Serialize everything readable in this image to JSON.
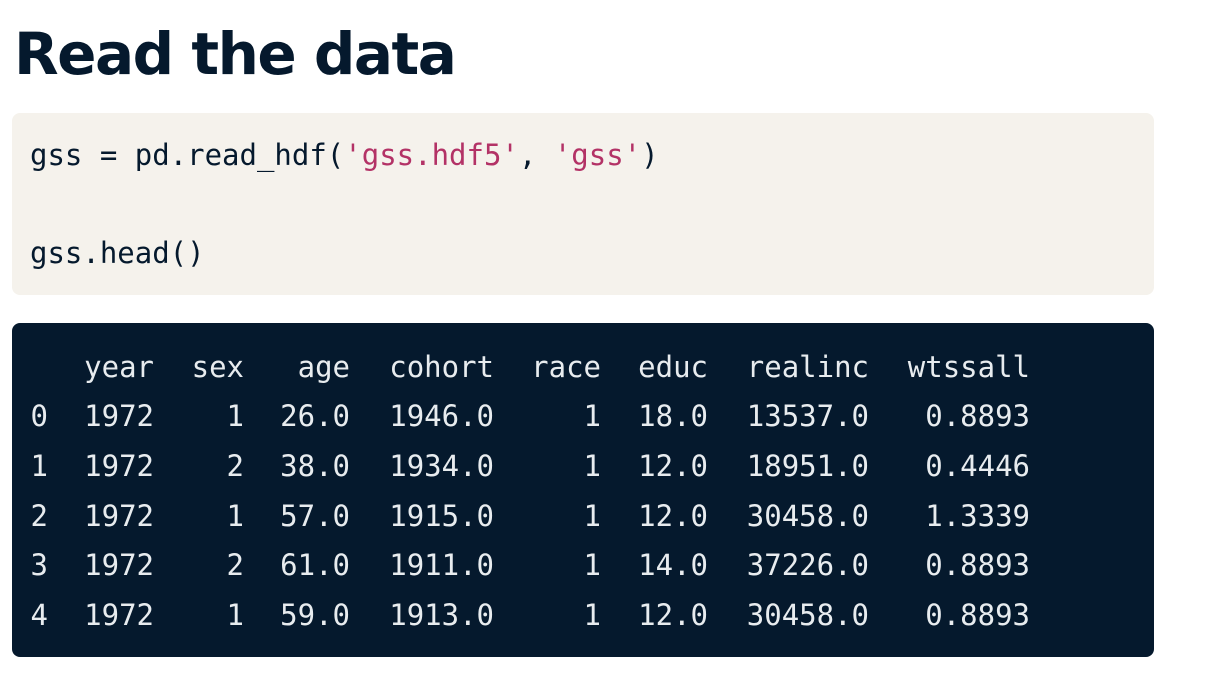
{
  "page": {
    "title": "Read the data"
  },
  "code": {
    "line1": {
      "p1": "gss = pd.read_hdf(",
      "s1": "'gss.hdf5'",
      "p2": ", ",
      "s2": "'gss'",
      "p3": ")"
    },
    "line2": "gss.head()"
  },
  "output": {
    "columns": [
      "year",
      "sex",
      "age",
      "cohort",
      "race",
      "educ",
      "realinc",
      "wtssall"
    ],
    "rows": [
      [
        "0",
        "1972",
        "1",
        "26.0",
        "1946.0",
        "1",
        "18.0",
        "13537.0",
        "0.8893"
      ],
      [
        "1",
        "1972",
        "2",
        "38.0",
        "1934.0",
        "1",
        "12.0",
        "18951.0",
        "0.4446"
      ],
      [
        "2",
        "1972",
        "1",
        "57.0",
        "1915.0",
        "1",
        "12.0",
        "30458.0",
        "1.3339"
      ],
      [
        "3",
        "1972",
        "2",
        "61.0",
        "1911.0",
        "1",
        "14.0",
        "37226.0",
        "0.8893"
      ],
      [
        "4",
        "1972",
        "1",
        "59.0",
        "1913.0",
        "1",
        "12.0",
        "30458.0",
        "0.8893"
      ]
    ]
  },
  "colors": {
    "title": "#05192d",
    "code_background": "#f5f2ec",
    "string_literal": "#b33266",
    "output_background": "#05192d",
    "output_text": "#e8ecef"
  }
}
